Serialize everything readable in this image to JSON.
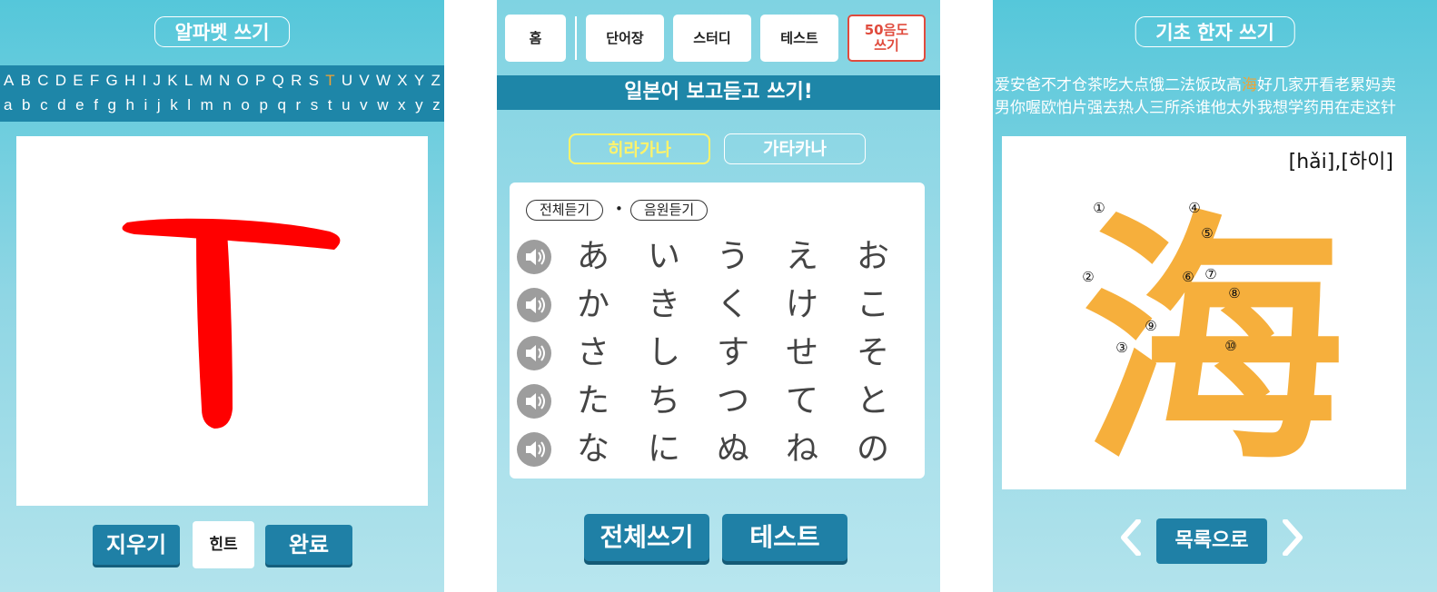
{
  "panel1": {
    "title": "알파벳 쓰기",
    "uppercase": [
      "A",
      "B",
      "C",
      "D",
      "E",
      "F",
      "G",
      "H",
      "I",
      "J",
      "K",
      "L",
      "M",
      "N",
      "O",
      "P",
      "Q",
      "R",
      "S",
      "T",
      "U",
      "V",
      "W",
      "X",
      "Y",
      "Z"
    ],
    "lowercase": [
      "a",
      "b",
      "c",
      "d",
      "e",
      "f",
      "g",
      "h",
      "i",
      "j",
      "k",
      "l",
      "m",
      "n",
      "o",
      "p",
      "q",
      "r",
      "s",
      "t",
      "u",
      "v",
      "w",
      "x",
      "y",
      "z"
    ],
    "selected_letter": "T",
    "stroke_color": "#ff0000",
    "buttons": {
      "erase": "지우기",
      "hint": "힌트",
      "done": "완료"
    }
  },
  "panel2": {
    "nav": {
      "home": "홈",
      "vocab": "단어장",
      "study": "스터디",
      "test": "테스트",
      "gojuon_line1": "50음도",
      "gojuon_line2": "쓰기"
    },
    "banner": "일본어 보고듣고 쓰기!",
    "tabs": {
      "hiragana": "히라가나",
      "katakana": "가타카나"
    },
    "active_tab": "hiragana",
    "controls": {
      "listen_all": "전체듣기",
      "dot": "•",
      "listen_audio": "음원듣기"
    },
    "rows": [
      [
        "あ",
        "い",
        "う",
        "え",
        "お"
      ],
      [
        "か",
        "き",
        "く",
        "け",
        "こ"
      ],
      [
        "さ",
        "し",
        "す",
        "せ",
        "そ"
      ],
      [
        "た",
        "ち",
        "つ",
        "て",
        "と"
      ],
      [
        "な",
        "に",
        "ぬ",
        "ね",
        "の"
      ]
    ],
    "bottom_buttons": {
      "write_all": "전체쓰기",
      "test": "테스트"
    }
  },
  "panel3": {
    "title": "기초 한자 쓰기",
    "hanzi_row1_before": "爱安爸不才仓茶吃大点饿二法饭改高",
    "hanzi_row1_selected": "海",
    "hanzi_row1_after": "好几家开看老累妈卖",
    "hanzi_row2": "男你喔欧怕片强去热人三所杀谁他太外我想学药用在走这针",
    "pinyin": "[hǎi],[하이]",
    "character": "海",
    "character_color": "#f6af3c",
    "stroke_numbers": [
      "①",
      "②",
      "③",
      "④",
      "⑤",
      "⑥",
      "⑦",
      "⑧",
      "⑨",
      "⑩"
    ],
    "back_button": "목록으로"
  },
  "colors": {
    "accent": "#1f80a6",
    "highlight": "#f0a334",
    "active_tab": "#fff36b",
    "gojuon_red": "#e04b3d"
  }
}
